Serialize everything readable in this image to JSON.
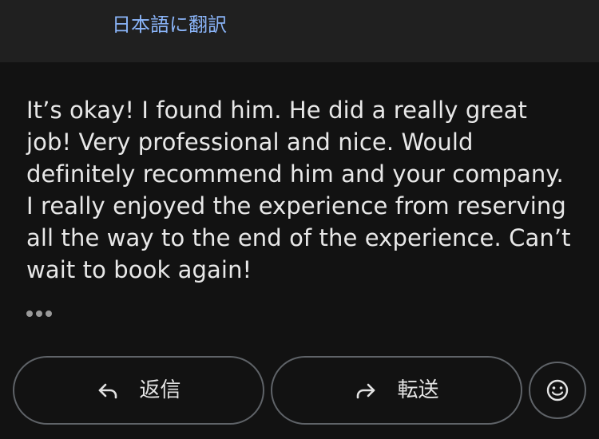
{
  "header": {
    "translate_label": "日本語に翻訳"
  },
  "message": {
    "body": "It’s okay! I found him. He did a really great job! Very professional and nice. Would definitely recommend him and your company. I really enjoyed the experience from reserving all the way to the end of the experience. Can’t wait to book again!"
  },
  "actions": {
    "reply_label": "返信",
    "forward_label": "転送"
  },
  "icons": {
    "more": "more-horiz-icon",
    "reply": "reply-arrow-icon",
    "forward": "forward-arrow-icon",
    "emoji": "smiley-icon"
  },
  "colors": {
    "background": "#121212",
    "header_band": "#202020",
    "link": "#8ab4f8",
    "border": "#5f6368"
  }
}
